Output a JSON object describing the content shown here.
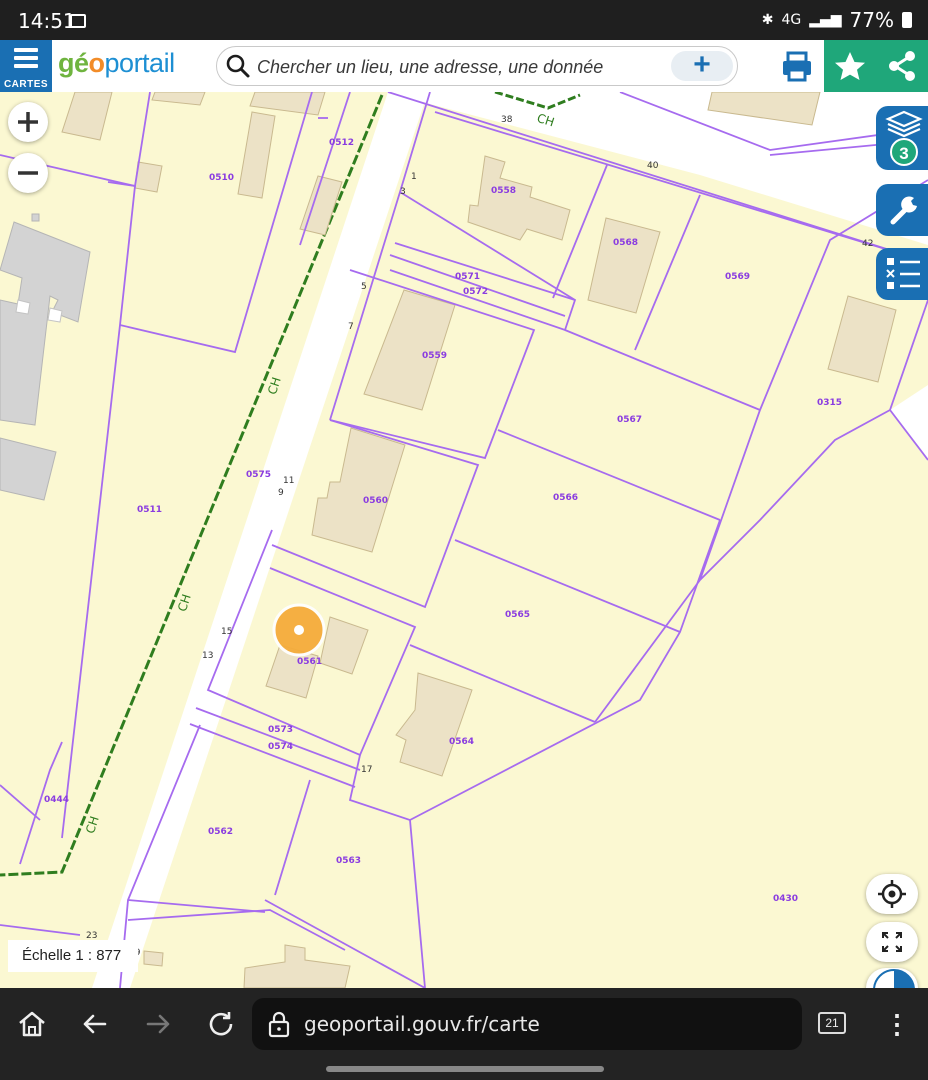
{
  "status_bar": {
    "time": "14:51",
    "battery": "77%",
    "icons": [
      "gallery-icon",
      "bluetooth-icon",
      "4g-icon",
      "signal-icon",
      "battery-icon"
    ],
    "network": "4G"
  },
  "toolbar": {
    "menu_label": "CARTES",
    "logo": {
      "g": "g",
      "e": "é",
      "o": "o",
      "rest": "portail"
    },
    "search_placeholder": "Chercher un lieu, une adresse, une donnée",
    "icons": [
      "menu-icon",
      "search-icon",
      "plus-icon",
      "print-icon",
      "star-icon",
      "share-icon"
    ]
  },
  "map": {
    "layers_count": "3",
    "scale_label": "Échelle 1 : 877",
    "road_label": "CH",
    "parcels": [
      {
        "id": "0512"
      },
      {
        "id": "0510"
      },
      {
        "id": "0558"
      },
      {
        "id": "0568"
      },
      {
        "id": "0569"
      },
      {
        "id": "0571"
      },
      {
        "id": "0572"
      },
      {
        "id": "0559"
      },
      {
        "id": "0567"
      },
      {
        "id": "0315"
      },
      {
        "id": "0575"
      },
      {
        "id": "0560"
      },
      {
        "id": "0566"
      },
      {
        "id": "0511"
      },
      {
        "id": "0565"
      },
      {
        "id": "0561"
      },
      {
        "id": "0573"
      },
      {
        "id": "0574"
      },
      {
        "id": "0564"
      },
      {
        "id": "0444"
      },
      {
        "id": "0562"
      },
      {
        "id": "0563"
      },
      {
        "id": "0430"
      }
    ],
    "street_numbers": [
      "38",
      "40",
      "42",
      "1",
      "3",
      "5",
      "7",
      "11",
      "9",
      "15",
      "13",
      "17",
      "23",
      "19"
    ],
    "colors": {
      "parcel_line": "#a66bef",
      "parcel_label": "#8a3ce0",
      "building": "#ece2c6",
      "road_boundary": "#2f7d1f",
      "marker": "#f5ac3b",
      "accent": "#1a6fb3",
      "green": "#1fa77a"
    }
  },
  "browser": {
    "url": "geoportail.gouv.fr/carte",
    "tab_count": "21",
    "icons": [
      "home-icon",
      "back-icon",
      "forward-icon",
      "reload-icon",
      "lock-icon",
      "tabs-icon",
      "more-icon"
    ]
  }
}
